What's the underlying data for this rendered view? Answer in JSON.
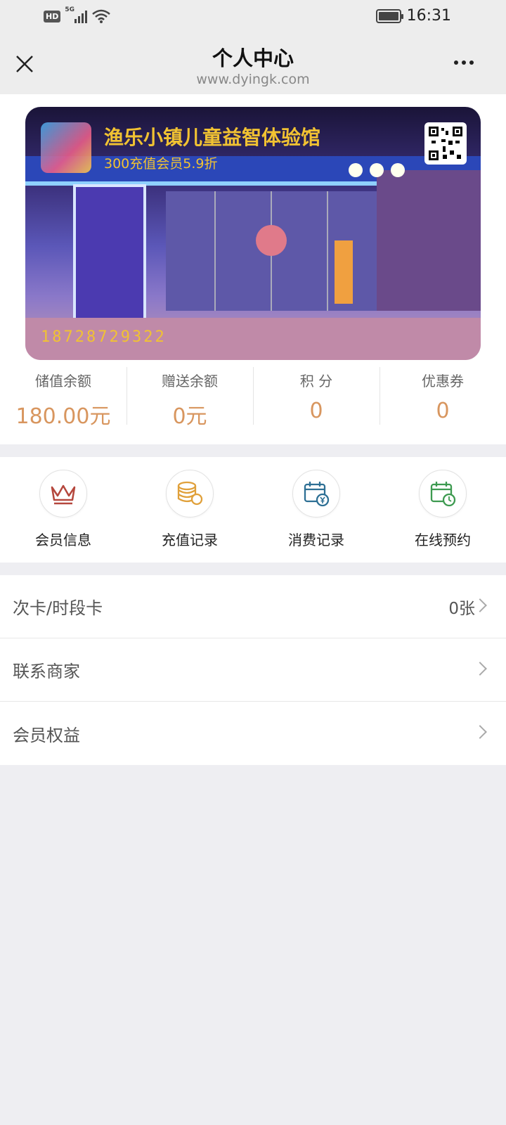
{
  "status_bar": {
    "hd": "HD",
    "network": "5G",
    "time": "16:31"
  },
  "header": {
    "title": "个人中心",
    "url": "www.dyingk.com"
  },
  "card": {
    "shop_name": "渔乐小镇儿童益智体验馆",
    "promo": "300充值会员5.9折",
    "card_number": "18728729322"
  },
  "stats": [
    {
      "label": "储值余额",
      "value": "180.00元"
    },
    {
      "label": "赠送余额",
      "value": "0元"
    },
    {
      "label": "积 分",
      "value": "0"
    },
    {
      "label": "优惠券",
      "value": "0"
    }
  ],
  "actions": [
    {
      "label": "会员信息",
      "icon": "crown-icon",
      "color": "#b5473d"
    },
    {
      "label": "充值记录",
      "icon": "coins-icon",
      "color": "#e0a03a"
    },
    {
      "label": "消费记录",
      "icon": "calendar-yen-icon",
      "color": "#2d6f94"
    },
    {
      "label": "在线预约",
      "icon": "calendar-clock-icon",
      "color": "#3d9a50"
    }
  ],
  "list": [
    {
      "label": "次卡/时段卡",
      "value": "0张"
    },
    {
      "label": "联系商家",
      "value": ""
    },
    {
      "label": "会员权益",
      "value": ""
    }
  ]
}
